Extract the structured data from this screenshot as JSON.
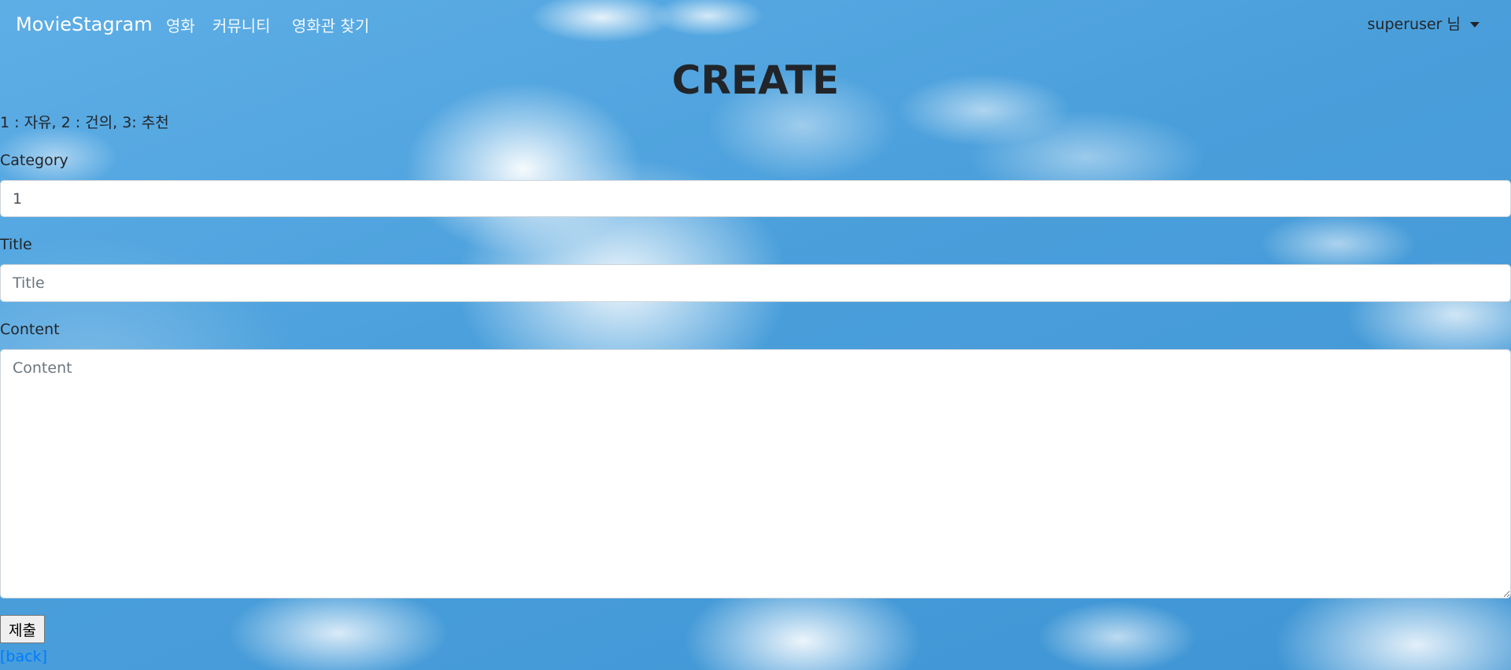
{
  "nav": {
    "brand": "MovieStagram",
    "links": [
      "영화",
      "커뮤니티",
      "영화관 찾기"
    ],
    "user_label": "superuser 님"
  },
  "page": {
    "title": "CREATE",
    "category_hint": "1 : 자유, 2 : 건의, 3: 추천"
  },
  "form": {
    "category": {
      "label": "Category",
      "value": "1"
    },
    "title": {
      "label": "Title",
      "placeholder": "Title",
      "value": ""
    },
    "content": {
      "label": "Content",
      "placeholder": "Content",
      "value": ""
    },
    "submit_label": "제출"
  },
  "back_link": "[back]",
  "colors": {
    "link": "#007bff",
    "text": "#212529",
    "sky": "#4a9fdb"
  }
}
